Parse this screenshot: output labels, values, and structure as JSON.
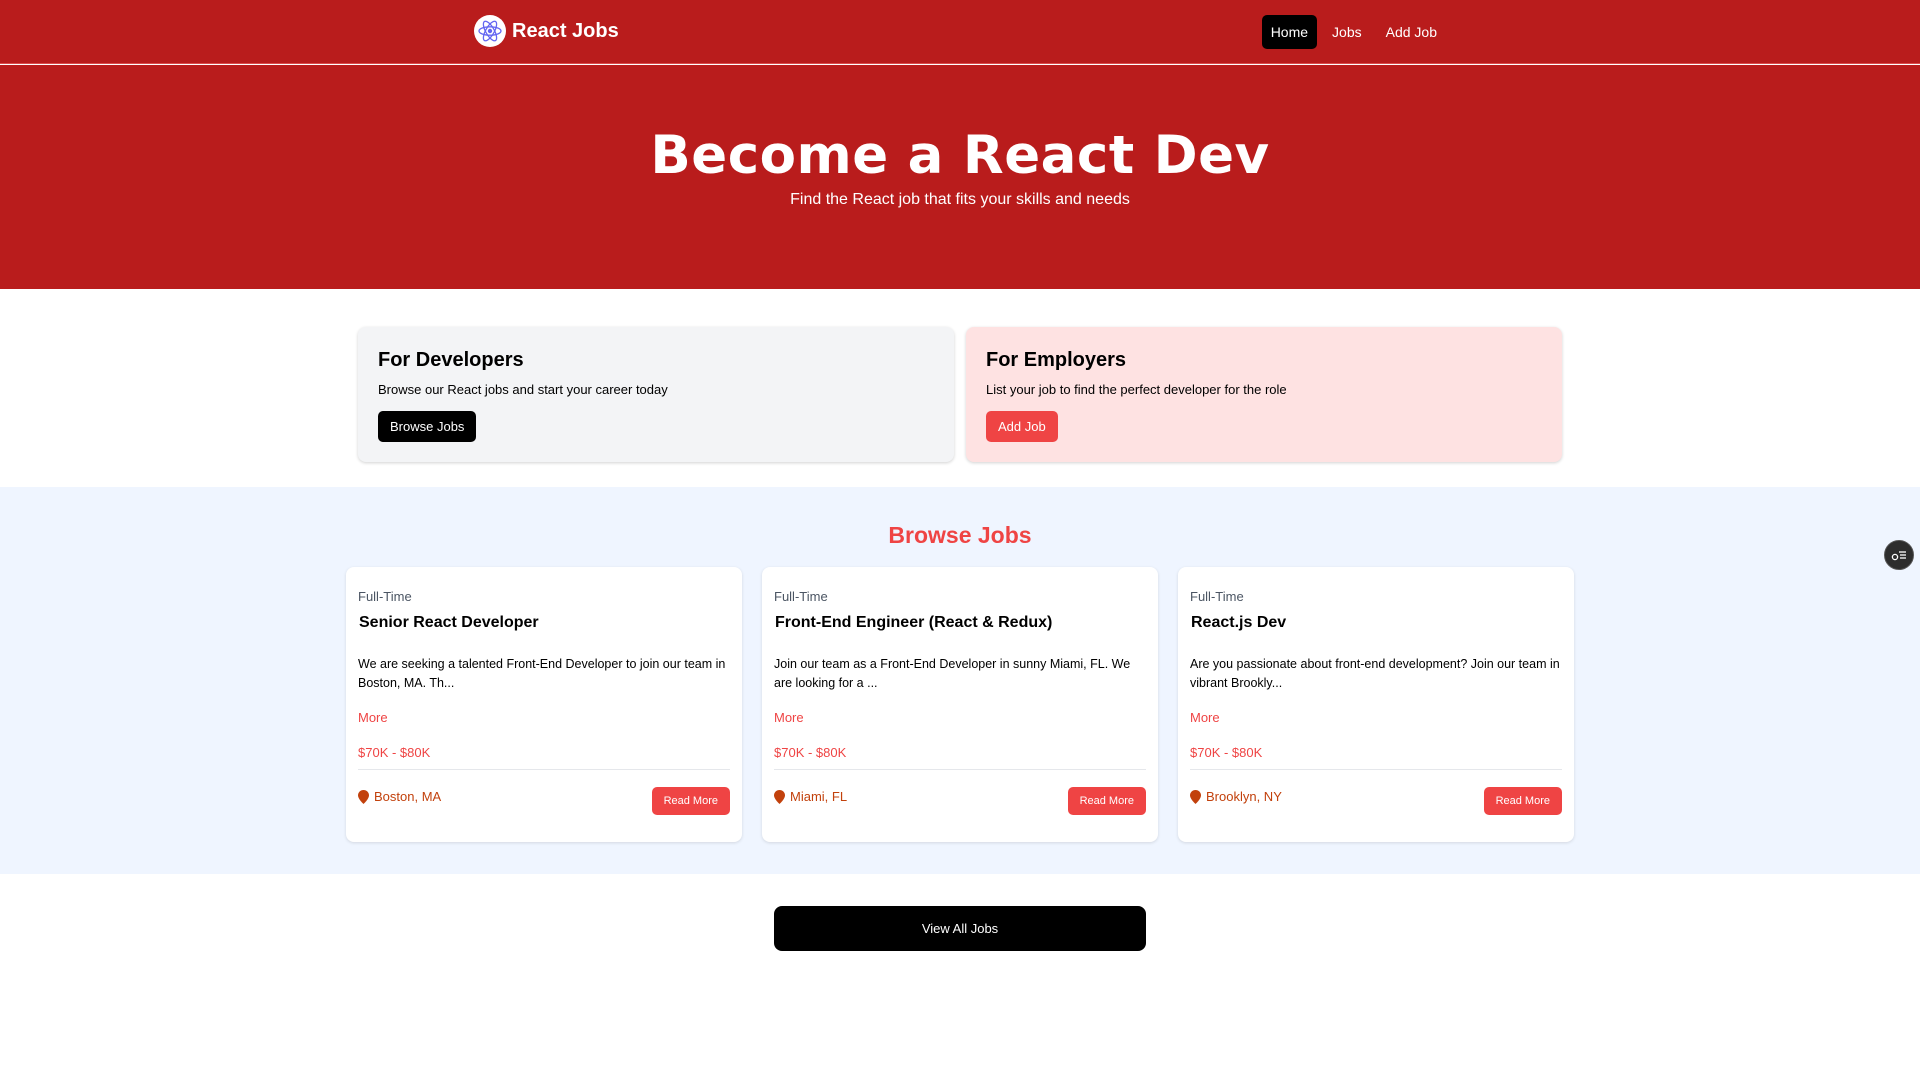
{
  "nav": {
    "brand": "React Jobs",
    "links": [
      "Home",
      "Jobs",
      "Add Job"
    ],
    "active_link": "Home"
  },
  "hero": {
    "title": "Become a React Dev",
    "subtitle": "Find the React job that fits your skills and needs"
  },
  "developers": {
    "title": "For Developers",
    "text": "Browse our React jobs and start your career today",
    "button": "Browse Jobs"
  },
  "employers": {
    "title": "For Employers",
    "text": "List your job to find the perfect developer for the role",
    "button": "Add Job"
  },
  "jobs": {
    "title": "Browse Jobs",
    "more_label": "More",
    "read_more_label": "Read More",
    "items": [
      {
        "type": "Full-Time",
        "title": "Senior React Developer",
        "description": "We are seeking a talented Front-End Developer to join our team in Boston, MA. Th...",
        "salary": "$70K - $80K",
        "location": "Boston, MA"
      },
      {
        "type": "Full-Time",
        "title": "Front-End Engineer (React & Redux)",
        "description": "Join our team as a Front-End Developer in sunny Miami, FL. We are looking for a ...",
        "salary": "$70K - $80K",
        "location": "Miami, FL"
      },
      {
        "type": "Full-Time",
        "title": "React.js Dev",
        "description": "Are you passionate about front-end development? Join our team in vibrant Brookly...",
        "salary": "$70K - $80K",
        "location": "Brooklyn, NY"
      }
    ]
  },
  "view_all": "View All Jobs",
  "colors": {
    "brand_red": "#b91c1c",
    "accent_red": "#ef4444",
    "section_bg": "#eff5ff",
    "location_orange": "#c2410c"
  },
  "icons": {
    "logo": "react-atom-icon",
    "location": "map-marker-icon",
    "widget": "toggle-panel-icon"
  }
}
